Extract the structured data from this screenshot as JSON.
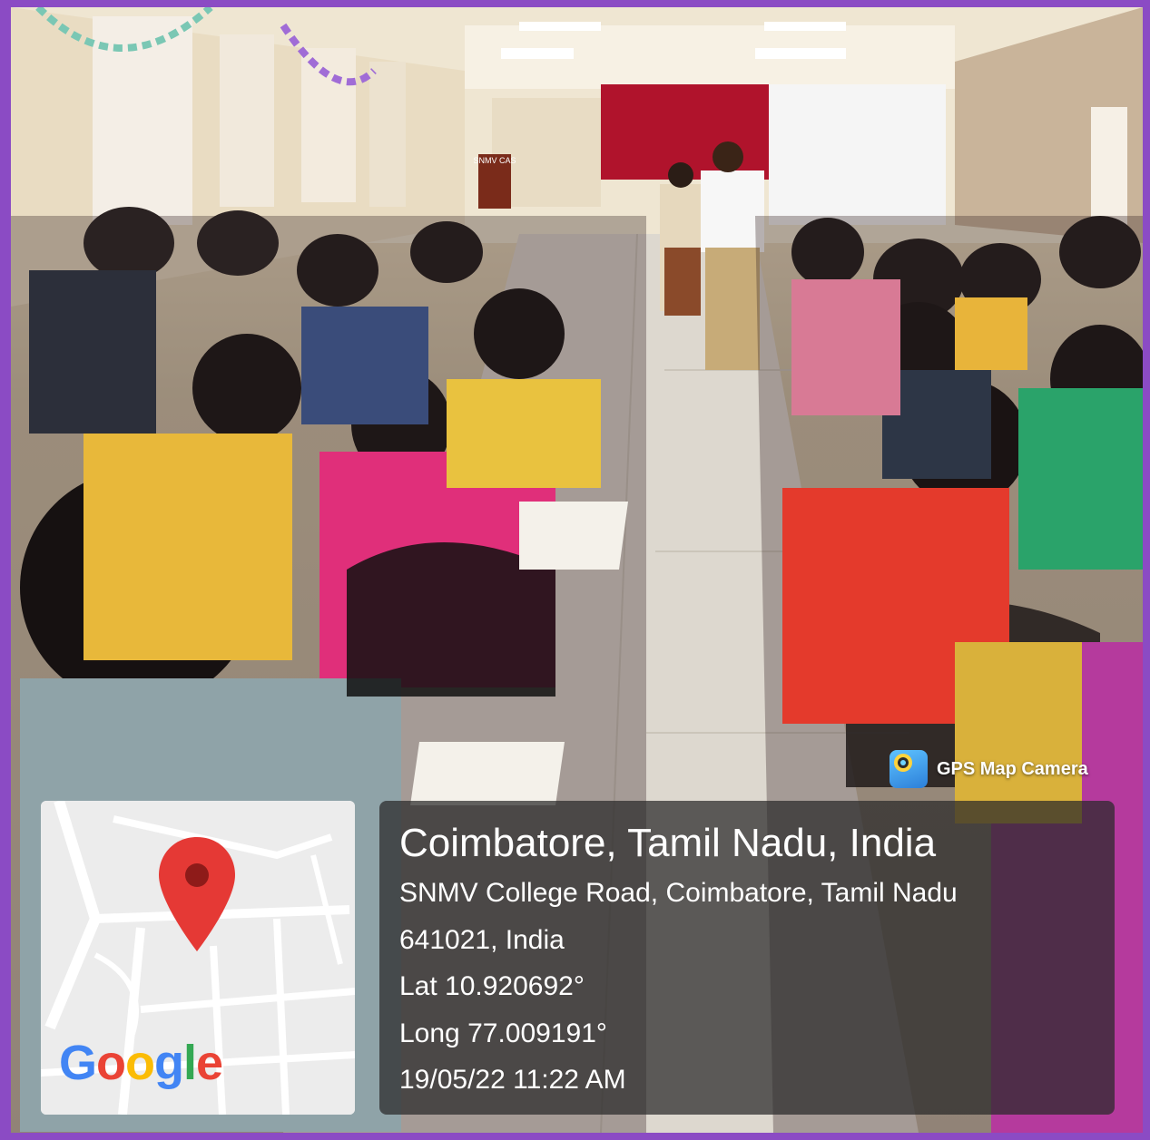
{
  "badge": {
    "label": "GPS Map Camera",
    "icon": "gps-camera-icon"
  },
  "map": {
    "logo_text": "Google",
    "pin_icon": "map-pin-icon",
    "logo_colors": [
      "#4285F4",
      "#EA4335",
      "#FBBC05",
      "#4285F4",
      "#34A853",
      "#EA4335"
    ]
  },
  "location": {
    "title": "Coimbatore, Tamil Nadu, India",
    "address_line1": "SNMV College Road, Coimbatore, Tamil Nadu",
    "address_line2": "641021, India",
    "latitude": "Lat 10.920692°",
    "longitude": "Long 77.009191°",
    "timestamp": "19/05/22 11:22 AM"
  },
  "scene": {
    "sign_text": "SNMV CAS"
  },
  "colors": {
    "frame": "#8b4bc4",
    "panel": "rgba(40,40,40,0.72)",
    "pin": "#e53935"
  }
}
